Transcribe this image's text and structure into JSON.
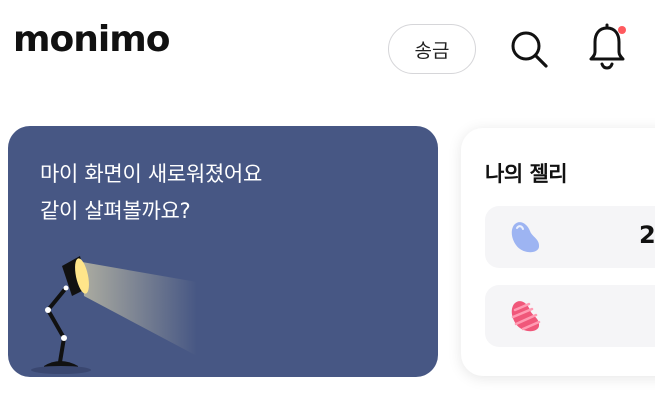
{
  "header": {
    "logo_text": "monimo",
    "send_label": "송금",
    "search_icon": "search-icon",
    "bell_icon": "bell-icon",
    "notification_dot_color": "#ff5a5f"
  },
  "banner": {
    "line1": "마이 화면이 새로워졌어요",
    "line2": "같이 살펴볼까요?",
    "background_color": "#475784",
    "illustration": "desk-lamp-icon"
  },
  "jelly_card": {
    "title": "나의 젤리",
    "rows": [
      {
        "icon": "blue-jelly-icon",
        "icon_color": "#9db4f2",
        "count": "2"
      },
      {
        "icon": "pink-jelly-icon",
        "icon_color": "#f0577a",
        "count": ""
      }
    ]
  }
}
